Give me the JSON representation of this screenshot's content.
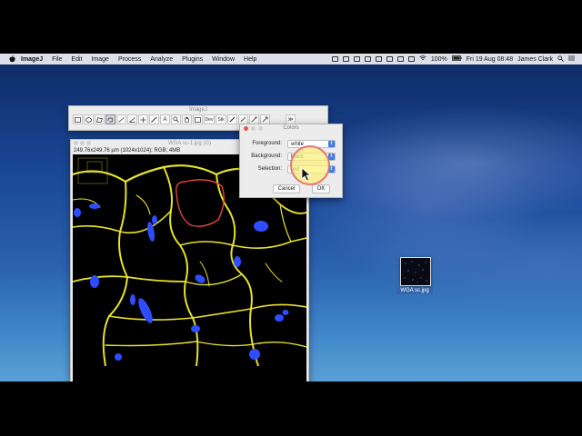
{
  "menubar": {
    "app_name": "ImageJ",
    "items": [
      "File",
      "Edit",
      "Image",
      "Process",
      "Analyze",
      "Plugins",
      "Window",
      "Help"
    ],
    "battery": "100%",
    "datetime": "Fri 19 Aug  08:48",
    "user": "James Clark"
  },
  "toolbar": {
    "title": "ImageJ",
    "dev_label": "Dev",
    "st_label": "Stk"
  },
  "image_window": {
    "title": "WGA sc-1.jpg (G)",
    "info": "249.76x249.76 µm (1024x1024); RGB; 4MB"
  },
  "colors_dialog": {
    "title": "Colors",
    "foreground_label": "Foreground:",
    "foreground_value": "white",
    "background_label": "Background:",
    "background_value": "black",
    "selection_label": "Selection:",
    "selection_value": "red",
    "cancel_label": "Cancel",
    "ok_label": "OK"
  },
  "desktop_file": {
    "label": "WGA sc.jpg"
  },
  "colors": {
    "membrane": "#e8e22a",
    "nuclei": "#2f4cff",
    "selection": "#e2483a"
  }
}
